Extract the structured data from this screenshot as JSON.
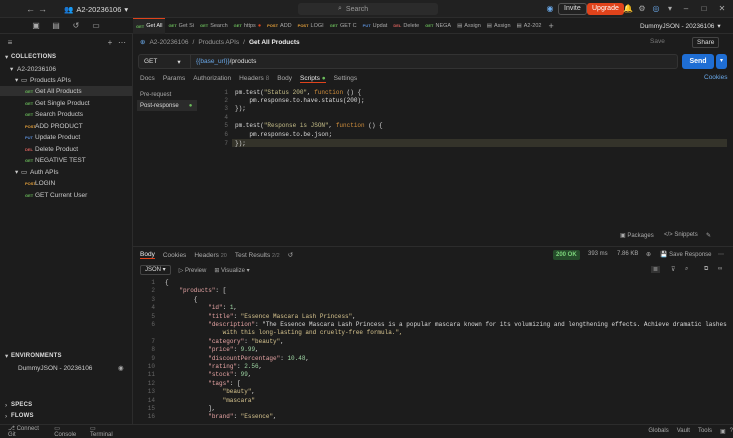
{
  "app": {
    "workspace": "A2-20236106",
    "search_placeholder": "Search",
    "invite": "Invite",
    "upgrade": "Upgrade"
  },
  "sidebar": {
    "collections_label": "COLLECTIONS",
    "collection": "A2-20236106",
    "folders": [
      {
        "name": "Products APIs",
        "items": [
          {
            "method": "GET",
            "label": "Get All Products",
            "selected": true
          },
          {
            "method": "GET",
            "label": "Get Single Product"
          },
          {
            "method": "GET",
            "label": "Search Products"
          },
          {
            "method": "POST",
            "label": "ADD PRODUCT"
          },
          {
            "method": "PUT",
            "label": "Update Product"
          },
          {
            "method": "DEL",
            "label": "Delete Product"
          },
          {
            "method": "GET",
            "label": "NEGATIVE TEST"
          }
        ]
      },
      {
        "name": "Auth APIs",
        "items": [
          {
            "method": "POST",
            "label": "LOGIN"
          },
          {
            "method": "GET",
            "label": "GET Current User"
          }
        ]
      }
    ],
    "environments_label": "ENVIRONMENTS",
    "environment": "DummyJSON - 20236106",
    "specs_label": "SPECS",
    "flows_label": "FLOWS"
  },
  "tabs": [
    {
      "m": "GET",
      "l": "Get All"
    },
    {
      "m": "GET",
      "l": "Get Si"
    },
    {
      "m": "GET",
      "l": "Search"
    },
    {
      "m": "GET",
      "l": "https"
    },
    {
      "m": "POST",
      "l": "ADD"
    },
    {
      "m": "POST",
      "l": "LOGI"
    },
    {
      "m": "GET",
      "l": "GET C"
    },
    {
      "m": "PUT",
      "l": "Updat"
    },
    {
      "m": "DEL",
      "l": "Delete"
    },
    {
      "m": "GET",
      "l": "NEGA"
    },
    {
      "m": "",
      "l": "Assign"
    },
    {
      "m": "",
      "l": "Assign"
    },
    {
      "m": "",
      "l": "A2-202"
    }
  ],
  "env_selector": "DummyJSON - 20236106",
  "request": {
    "breadcrumb_root": "A2-20236106",
    "breadcrumb_folder": "Products APIs",
    "breadcrumb_current": "Get All Products",
    "save": "Save",
    "share": "Share",
    "method": "GET",
    "url_var": "{{base_url}}",
    "url_path": "/products",
    "send": "Send",
    "cookies": "Cookies",
    "tabs": [
      "Docs",
      "Params",
      "Authorization",
      "Headers",
      "Body",
      "Scripts",
      "Settings"
    ],
    "headers_count": "8",
    "active_tab": "Scripts"
  },
  "scripts": {
    "pre": "Pre-request",
    "post": "Post-response"
  },
  "code": [
    [
      "1",
      "pm.test(\"Status 200\", function () {"
    ],
    [
      "2",
      "    pm.response.to.have.status(200);"
    ],
    [
      "3",
      "});"
    ],
    [
      "4",
      ""
    ],
    [
      "5",
      "pm.test(\"Response is JSON\", function () {"
    ],
    [
      "6",
      "    pm.response.to.be.json;"
    ],
    [
      "7",
      "});"
    ]
  ],
  "snippets": {
    "packages": "Packages",
    "snippets": "Snippets"
  },
  "response": {
    "tabs": [
      "Body",
      "Cookies",
      "Headers",
      "Test Results"
    ],
    "headers_count": "20",
    "tests": "2/2",
    "status": "200 OK",
    "time": "393 ms",
    "size": "7.86 KB",
    "save": "Save Response",
    "format": "JSON",
    "preview": "Preview",
    "visualize": "Visualize",
    "lines": [
      [
        "1",
        "{"
      ],
      [
        "2",
        "    \"products\": ["
      ],
      [
        "3",
        "        {"
      ],
      [
        "4",
        "            \"id\": 1,"
      ],
      [
        "5",
        "            \"title\": \"Essence Mascara Lash Princess\","
      ],
      [
        "6",
        "            \"description\": \"The Essence Mascara Lash Princess is a popular mascara known for its volumizing and lengthening effects. Achieve dramatic lashes"
      ],
      [
        "",
        "                with this long-lasting and cruelty-free formula.\","
      ],
      [
        "7",
        "            \"category\": \"beauty\","
      ],
      [
        "8",
        "            \"price\": 9.99,"
      ],
      [
        "9",
        "            \"discountPercentage\": 10.48,"
      ],
      [
        "10",
        "            \"rating\": 2.56,"
      ],
      [
        "11",
        "            \"stock\": 99,"
      ],
      [
        "12",
        "            \"tags\": ["
      ],
      [
        "13",
        "                \"beauty\","
      ],
      [
        "14",
        "                \"mascara\""
      ],
      [
        "15",
        "            ],"
      ],
      [
        "16",
        "            \"brand\": \"Essence\","
      ]
    ]
  },
  "statusbar": {
    "connect": "Connect Git",
    "console": "Console",
    "terminal": "Terminal",
    "globals": "Globals",
    "vault": "Vault",
    "tools": "Tools"
  }
}
